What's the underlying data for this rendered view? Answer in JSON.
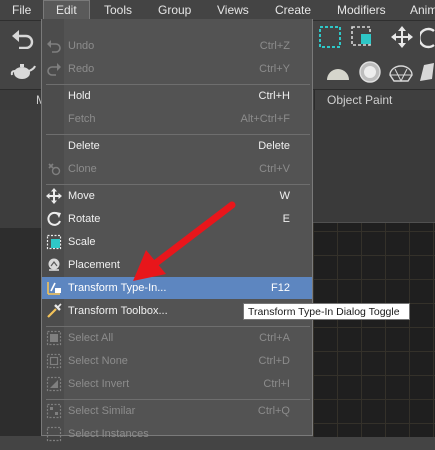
{
  "menubar": {
    "items": [
      "File",
      "Edit",
      "Tools",
      "Group",
      "Views",
      "Create",
      "Modifiers",
      "Anim"
    ]
  },
  "ribbon": {
    "tab_partial": "M",
    "object_paint": "Object Paint"
  },
  "edit_menu": {
    "items": [
      {
        "label": "Undo",
        "shortcut": "Ctrl+Z",
        "disabled": true,
        "icon": "undo-icon"
      },
      {
        "label": "Redo",
        "shortcut": "Ctrl+Y",
        "disabled": true,
        "icon": "redo-icon"
      },
      {
        "label": "Hold",
        "shortcut": "Ctrl+H",
        "disabled": false
      },
      {
        "label": "Fetch",
        "shortcut": "Alt+Ctrl+F",
        "disabled": true
      },
      {
        "label": "Delete",
        "shortcut": "Delete",
        "disabled": false
      },
      {
        "label": "Clone",
        "shortcut": "Ctrl+V",
        "disabled": true,
        "icon": "clone-icon"
      },
      {
        "label": "Move",
        "shortcut": "W",
        "disabled": false,
        "icon": "move-icon"
      },
      {
        "label": "Rotate",
        "shortcut": "E",
        "disabled": false,
        "icon": "rotate-icon"
      },
      {
        "label": "Scale",
        "shortcut": "",
        "disabled": false,
        "icon": "scale-icon"
      },
      {
        "label": "Placement",
        "shortcut": "",
        "disabled": false,
        "icon": "placement-icon"
      },
      {
        "label": "Transform Type-In...",
        "shortcut": "F12",
        "disabled": false,
        "highlighted": true,
        "icon": "transform-type-in-icon"
      },
      {
        "label": "Transform Toolbox...",
        "shortcut": "",
        "disabled": false,
        "icon": "transform-toolbox-icon"
      },
      {
        "label": "Select All",
        "shortcut": "Ctrl+A",
        "disabled": true,
        "icon": "select-all-icon"
      },
      {
        "label": "Select None",
        "shortcut": "Ctrl+D",
        "disabled": true,
        "icon": "select-none-icon"
      },
      {
        "label": "Select Invert",
        "shortcut": "Ctrl+I",
        "disabled": true,
        "icon": "select-invert-icon"
      },
      {
        "label": "Select Similar",
        "shortcut": "Ctrl+Q",
        "disabled": true,
        "icon": "select-similar-icon"
      },
      {
        "label": "Select Instances",
        "shortcut": "",
        "disabled": true,
        "icon": "select-instances-icon"
      }
    ]
  },
  "tooltip": {
    "text": "Transform Type-In Dialog Toggle"
  },
  "colors": {
    "highlight": "#5d86c0",
    "annotation_arrow": "#e8161b",
    "viewport_grid": "#34312a",
    "selection_cyan": "#2fc7c7"
  }
}
